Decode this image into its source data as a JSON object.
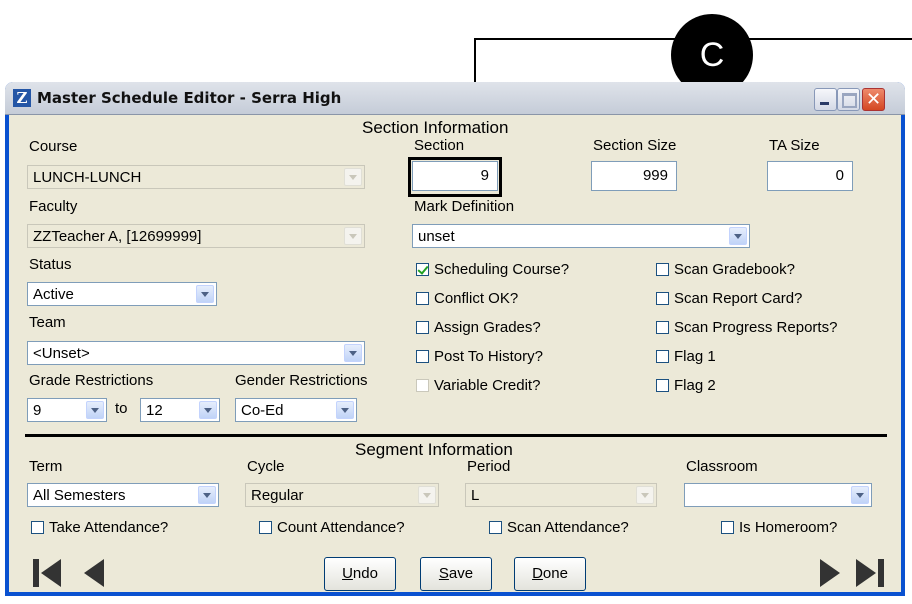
{
  "callout": {
    "letter": "C"
  },
  "window": {
    "title": "Master Schedule Editor - Serra High",
    "app_icon": "Z"
  },
  "section": {
    "header": "Section Information",
    "course_label": "Course",
    "course_value": "LUNCH-LUNCH",
    "faculty_label": "Faculty",
    "faculty_value": "ZZTeacher A,  [12699999]",
    "status_label": "Status",
    "status_value": "Active",
    "team_label": "Team",
    "team_value": "<Unset>",
    "grade_label": "Grade Restrictions",
    "grade_from": "9",
    "grade_to_label": "to",
    "grade_to": "12",
    "gender_label": "Gender Restrictions",
    "gender_value": "Co-Ed",
    "section_label": "Section",
    "section_value": "9",
    "section_size_label": "Section Size",
    "section_size_value": "999",
    "ta_size_label": "TA Size",
    "ta_size_value": "0",
    "mark_def_label": "Mark Definition",
    "mark_def_value": "unset",
    "checks": {
      "scheduling_course": {
        "label": "Scheduling Course?",
        "checked": true
      },
      "conflict_ok": {
        "label": "Conflict OK?",
        "checked": false
      },
      "assign_grades": {
        "label": "Assign Grades?",
        "checked": false
      },
      "post_to_history": {
        "label": "Post To History?",
        "checked": false
      },
      "variable_credit": {
        "label": "Variable Credit?",
        "checked": false
      },
      "scan_gradebook": {
        "label": "Scan Gradebook?",
        "checked": false
      },
      "scan_report_card": {
        "label": "Scan Report Card?",
        "checked": false
      },
      "scan_progress_reports": {
        "label": "Scan Progress Reports?",
        "checked": false
      },
      "flag1": {
        "label": "Flag 1",
        "checked": false
      },
      "flag2": {
        "label": "Flag 2",
        "checked": false
      }
    }
  },
  "segment": {
    "header": "Segment Information",
    "term_label": "Term",
    "term_value": "All Semesters",
    "cycle_label": "Cycle",
    "cycle_value": "Regular",
    "period_label": "Period",
    "period_value": "L",
    "classroom_label": "Classroom",
    "classroom_value": "",
    "take_attendance": "Take Attendance?",
    "count_attendance": "Count Attendance?",
    "scan_attendance": "Scan Attendance?",
    "is_homeroom": "Is Homeroom?"
  },
  "buttons": {
    "undo_u": "U",
    "undo_rest": "ndo",
    "save_u": "S",
    "save_rest": "ave",
    "done_u": "D",
    "done_rest": "one"
  },
  "colors": {
    "titlebar": "#c5ccd8",
    "dialog_bg": "#ece9d8",
    "window_border": "#0a51d0"
  }
}
